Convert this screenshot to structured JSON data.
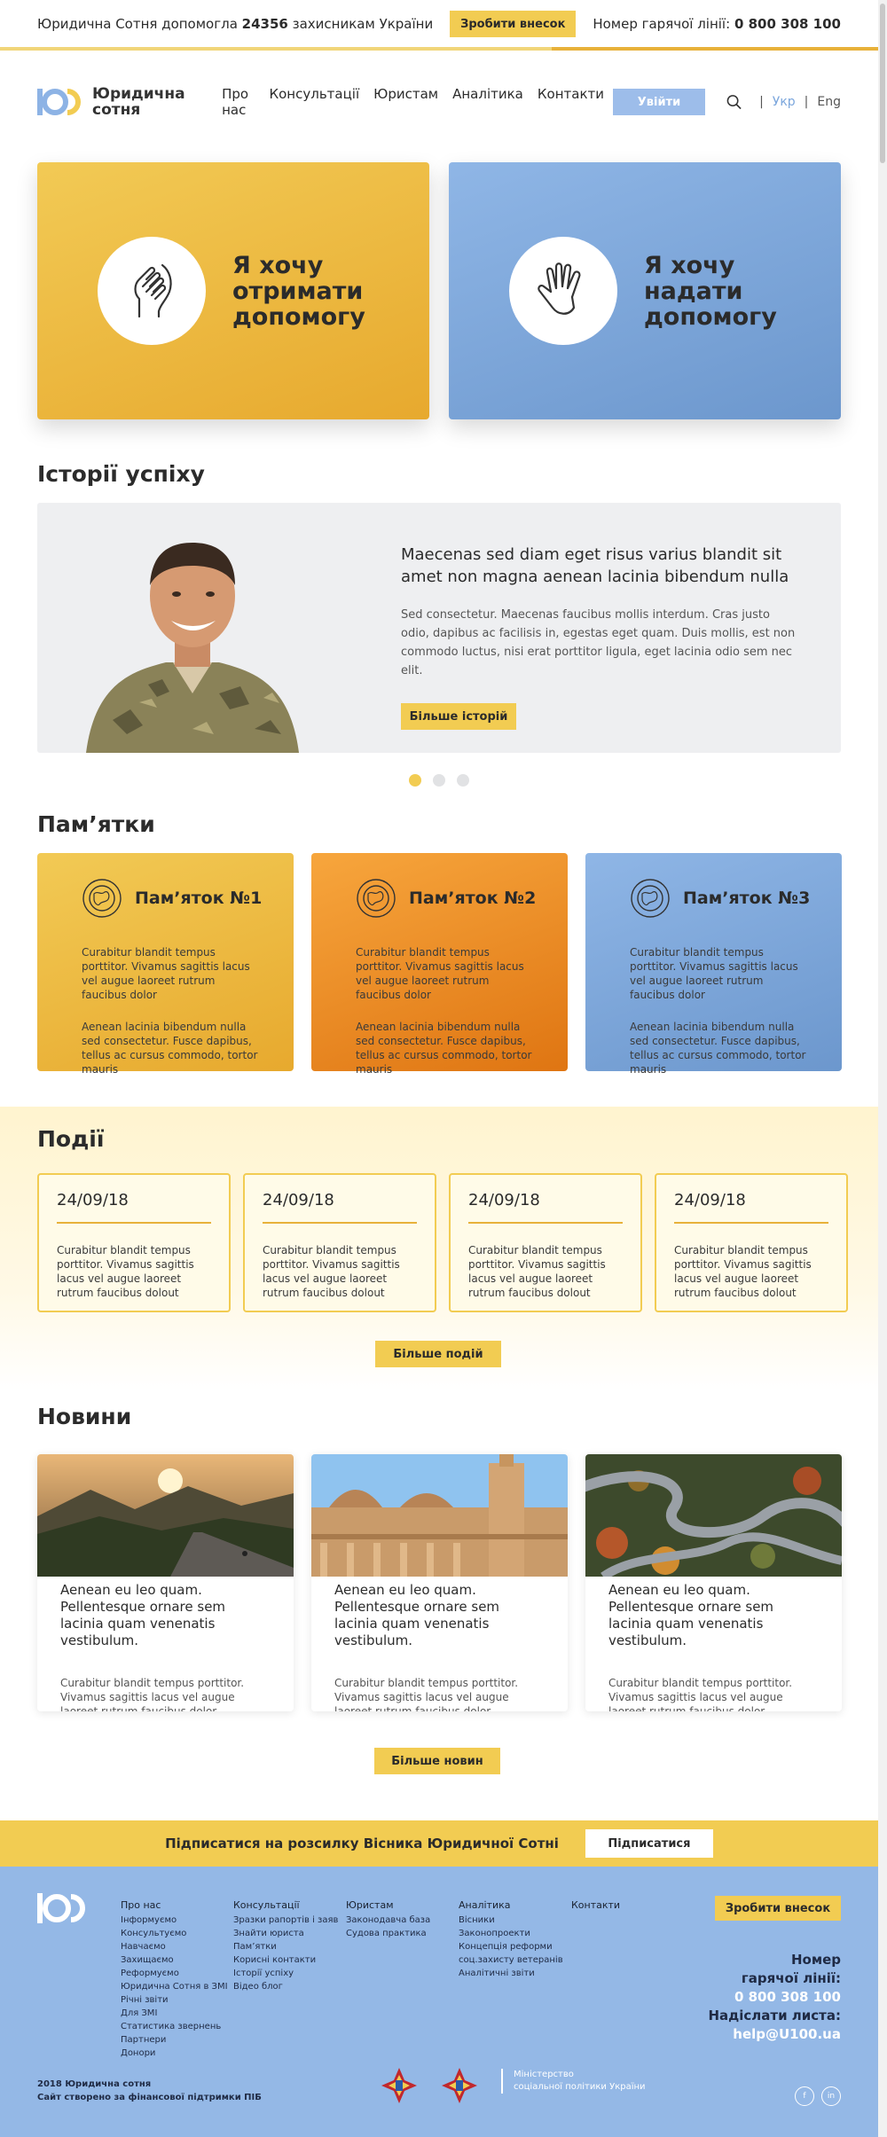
{
  "topbar": {
    "text_before": "Юридична Сотня допомогла",
    "count": "24356",
    "text_after": "захисникам України",
    "donate": "Зробити внесок",
    "hotline_label": "Номер гарячої лінії:",
    "hotline_number": "0 800 308 100"
  },
  "nav": {
    "logo_line1": "Юридична",
    "logo_line2": "сотня",
    "items": [
      "Про нас",
      "Консультації",
      "Юристам",
      "Аналітика",
      "Контакти"
    ],
    "login": "Увійти",
    "lang_ua": "Укр",
    "lang_en": "Eng"
  },
  "hero": {
    "get_help": "Я хочу отримати допомогу",
    "give_help": "Я хочу надати допомогу"
  },
  "stories": {
    "heading": "Історії успіху",
    "title": "Maecenas sed diam eget risus varius blandit sit amet non magna aenean lacinia bibendum nulla",
    "text": "Sed consectetur. Maecenas faucibus mollis interdum. Cras justo odio, dapibus ac facilisis in, egestas eget quam. Duis mollis, est non commodo luctus, nisi erat porttitor ligula, eget lacinia odio sem nec elit.",
    "button": "Більше історій"
  },
  "memos": {
    "heading": "Пам’ятки",
    "items": [
      {
        "title": "Пам’яток №1",
        "p1": "Curabitur blandit tempus porttitor. Vivamus sagittis lacus vel augue laoreet rutrum faucibus dolor",
        "p2": "Aenean lacinia bibendum nulla sed consectetur. Fusce dapibus, tellus ac cursus commodo, tortor mauris"
      },
      {
        "title": "Пам’яток №2",
        "p1": "Curabitur blandit tempus porttitor. Vivamus sagittis lacus vel augue laoreet rutrum faucibus dolor",
        "p2": "Aenean lacinia bibendum nulla sed consectetur. Fusce dapibus, tellus ac cursus commodo, tortor mauris"
      },
      {
        "title": "Пам’яток №3",
        "p1": "Curabitur blandit tempus porttitor. Vivamus sagittis lacus vel augue laoreet rutrum faucibus dolor",
        "p2": "Aenean lacinia bibendum nulla sed consectetur. Fusce dapibus, tellus ac cursus commodo, tortor mauris"
      }
    ]
  },
  "events": {
    "heading": "Події",
    "items": [
      {
        "date": "24/09/18",
        "text": "Curabitur blandit tempus porttitor. Vivamus sagittis lacus vel augue laoreet rutrum faucibus dolout"
      },
      {
        "date": "24/09/18",
        "text": "Curabitur blandit tempus porttitor. Vivamus sagittis lacus vel augue laoreet rutrum faucibus dolout"
      },
      {
        "date": "24/09/18",
        "text": "Curabitur blandit tempus porttitor. Vivamus sagittis lacus vel augue laoreet rutrum faucibus dolout"
      },
      {
        "date": "24/09/18",
        "text": "Curabitur blandit tempus porttitor. Vivamus sagittis lacus vel augue laoreet rutrum faucibus dolout"
      }
    ],
    "button": "Більше подій"
  },
  "news": {
    "heading": "Новини",
    "items": [
      {
        "title": "Aenean eu leo quam. Pellentesque ornare sem lacinia quam venenatis vestibulum.",
        "text": "Curabitur blandit tempus porttitor. Vivamus sagittis lacus vel augue laoreet rutrum faucibus dolor."
      },
      {
        "title": "Aenean eu leo quam. Pellentesque ornare sem lacinia quam venenatis vestibulum.",
        "text": "Curabitur blandit tempus porttitor. Vivamus sagittis lacus vel augue laoreet rutrum faucibus dolor."
      },
      {
        "title": "Aenean eu leo quam. Pellentesque ornare sem lacinia quam venenatis vestibulum.",
        "text": "Curabitur blandit tempus porttitor. Vivamus sagittis lacus vel augue laoreet rutrum faucibus dolor."
      }
    ],
    "button": "Більше новин"
  },
  "subscribe": {
    "text": "Підписатися на розсилку Вісника Юридичної Сотні",
    "button": "Підписатися"
  },
  "footer": {
    "col1": {
      "head": "Про нас",
      "items": [
        "Інформуємо",
        "Консультуємо",
        "Навчаємо",
        "Захищаємо",
        "Реформуємо",
        "Юридична Сотня в ЗМІ",
        "Річні звіти",
        "Для ЗМІ",
        "Статистика звернень",
        "Партнери",
        "Донори"
      ]
    },
    "col2": {
      "head": "Консультації",
      "items": [
        "Зразки рапортів і заяв",
        "Знайти юриста",
        "Пам’ятки",
        "Корисні контакти",
        "Історії успіху",
        "Відео блог"
      ]
    },
    "col3": {
      "head": "Юристам",
      "items": [
        "Законодавча база",
        "Судова практика"
      ]
    },
    "col4": {
      "head": "Аналітика",
      "items": [
        "Вісники",
        "Законопроекти",
        "Концепція реформи",
        "соц.захисту ветеранів",
        "Аналітичні звіти"
      ]
    },
    "col5": {
      "head": "Контакти",
      "items": []
    },
    "donate": "Зробити внесок",
    "hotline_line1": "Номер",
    "hotline_line2": "гарячої лінії:",
    "hotline_number": "0 800 308 100",
    "email_label": "Надіслати листа:",
    "email": "help@U100.ua",
    "copy1": "2018 Юридична сотня",
    "copy2": "Сайт створено за фінансової підтримки ПІБ",
    "ministry_line1": "Міністерство",
    "ministry_line2": "соціальної політики України",
    "social1": "f",
    "social2": "in"
  },
  "colors": {
    "yellow": "#f2cc52",
    "orange": "#e8892a",
    "blue": "#8db3e5",
    "dark": "#2b2b2b"
  }
}
